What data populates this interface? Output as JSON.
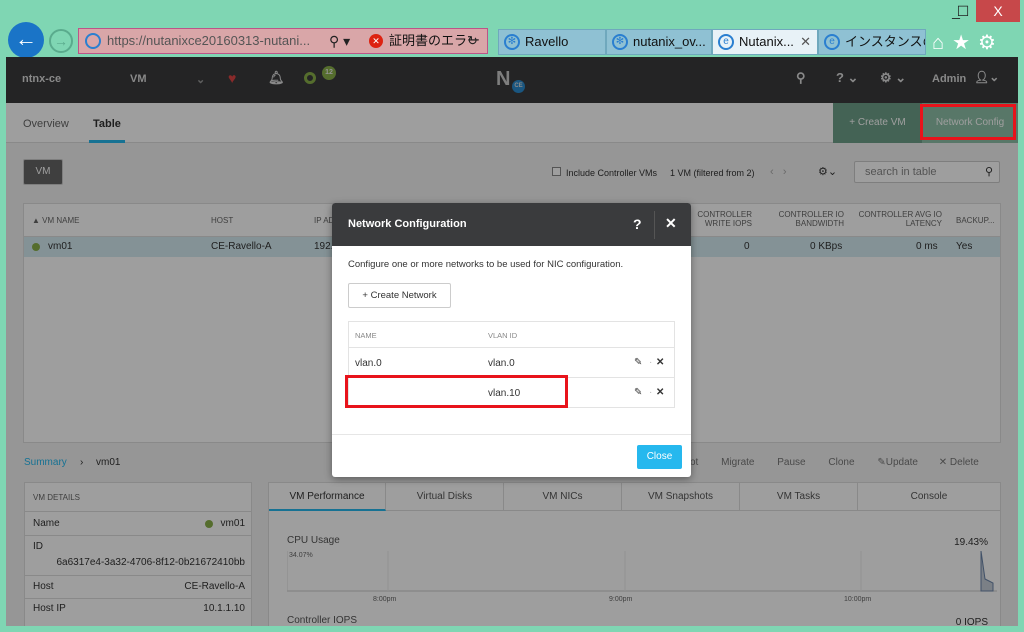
{
  "browser": {
    "url": "https://nutanixce20160313-nutani...",
    "cert_error": "証明書のエラー",
    "tabs": [
      {
        "label": "Ravello"
      },
      {
        "label": "nutanix_ov..."
      },
      {
        "label": "Nutanix...",
        "active": true
      },
      {
        "label": "インスタンスの..."
      }
    ],
    "window_buttons": {
      "minimize": "_",
      "maximize": "☐",
      "close": "X"
    }
  },
  "header": {
    "cluster": "ntnx-ce",
    "menu": "VM",
    "alert_count": "12",
    "logo": "N",
    "logo_badge": "CE",
    "user": "Admin"
  },
  "subnav": {
    "overview": "Overview",
    "table": "Table",
    "create_vm": "+ Create VM",
    "network_config": "Network Config"
  },
  "toolbar": {
    "vm_button": "VM",
    "include_cvm": "Include Controller VMs",
    "count": "1 VM (filtered from 2)",
    "search_placeholder": "search in table"
  },
  "table": {
    "columns": [
      "▲ VM NAME",
      "HOST",
      "IP AD",
      "CONTROLLER WRITE IOPS",
      "CONTROLLER IO BANDWIDTH",
      "CONTROLLER AVG IO LATENCY",
      "BACKUP..."
    ],
    "rows": [
      {
        "name": "vm01",
        "host": "CE-Ravello-A",
        "ip": "192.",
        "write_iops": "0",
        "bandwidth": "0 KBps",
        "latency": "0 ms",
        "backup": "Yes"
      }
    ]
  },
  "summary": {
    "breadcrumb": "Summary",
    "vm": "vm01",
    "actions": [
      "ot",
      "Migrate",
      "Pause",
      "Clone",
      "Update",
      "Delete"
    ]
  },
  "vm_details": {
    "title": "VM DETAILS",
    "name_label": "Name",
    "name": "vm01",
    "id_label": "ID",
    "id": "6a6317e4-3a32-4706-8f12-0b21672410bb",
    "host_label": "Host",
    "host": "CE-Ravello-A",
    "hostip_label": "Host IP",
    "hostip": "10.1.1.10"
  },
  "perf_tabs": [
    "VM Performance",
    "Virtual Disks",
    "VM NICs",
    "VM Snapshots",
    "VM Tasks",
    "Console"
  ],
  "perf": {
    "cpu_label": "CPU Usage",
    "cpu_value": "19.43%",
    "cpu_max": "34.07%",
    "times": [
      "8:00pm",
      "9:00pm",
      "10:00pm"
    ],
    "iops_label": "Controller IOPS",
    "iops_value": "0 IOPS"
  },
  "modal": {
    "title": "Network Configuration",
    "help": "?",
    "close_x": "✕",
    "description": "Configure one or more networks to be used for NIC configuration.",
    "create": "+ Create Network",
    "columns": [
      "NAME",
      "VLAN ID"
    ],
    "rows": [
      {
        "name": "vlan.0",
        "vlan": "vlan.0"
      },
      {
        "name": "",
        "vlan": "vlan.10"
      }
    ],
    "close": "Close"
  },
  "colors": {
    "accent": "#26b8ee",
    "highlight": "#e8131b",
    "header": "#3a3b3d",
    "window": "#7fd6b3"
  }
}
